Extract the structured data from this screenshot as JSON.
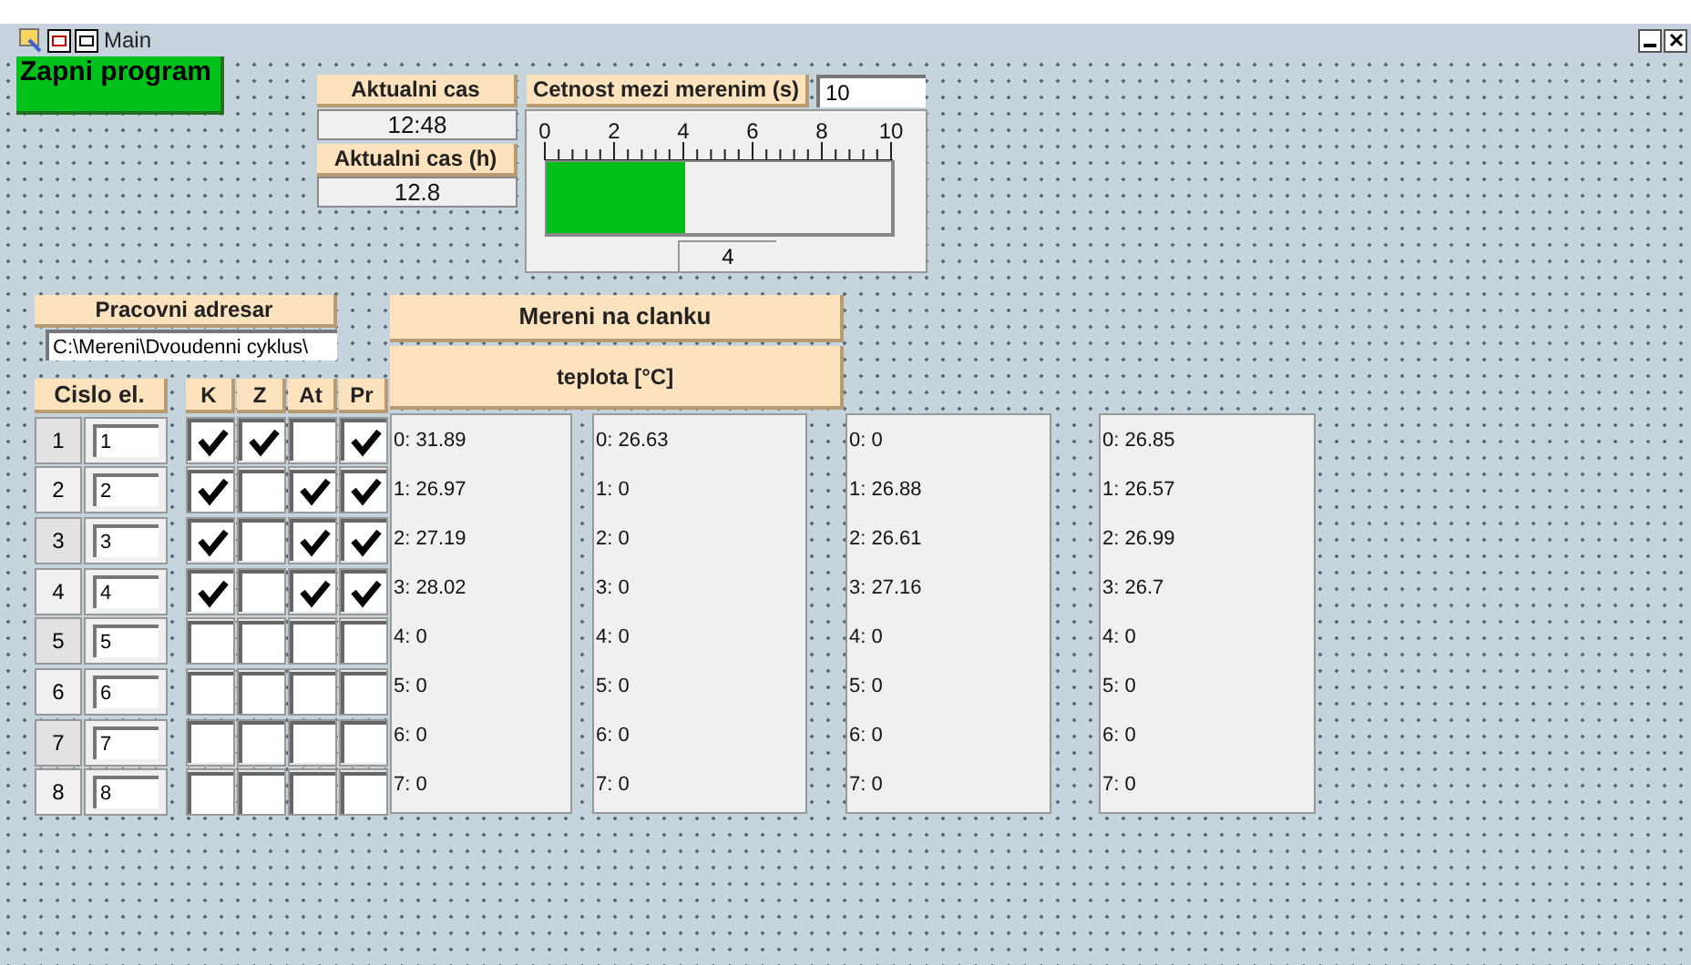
{
  "window": {
    "title": "Main"
  },
  "start_button": {
    "label": "Zapni program",
    "on": true
  },
  "current_time": {
    "label": "Aktualni cas",
    "value": "12:48"
  },
  "current_time_h": {
    "label": "Aktualni cas (h)",
    "value": "12.8"
  },
  "frequency": {
    "label": "Cetnost mezi merenim (s)",
    "value": "10"
  },
  "slider": {
    "ticks": [
      "0",
      "2",
      "4",
      "6",
      "8",
      "10"
    ],
    "level": 0.4,
    "reading": "4"
  },
  "directory": {
    "label": "Pracovni adresar",
    "value": "C:\\Mereni\\Dvoudenni cyklus\\"
  },
  "measurement": {
    "title": "Mereni na clanku",
    "unit": "teplota [°C]"
  },
  "table": {
    "number_header": "Cislo el.",
    "check_headers": [
      "K",
      "Z",
      "At",
      "Pr"
    ],
    "rows": [
      {
        "number": "1",
        "value": "1",
        "checks": [
          true,
          true,
          false,
          true
        ]
      },
      {
        "number": "2",
        "value": "2",
        "checks": [
          true,
          false,
          true,
          true
        ]
      },
      {
        "number": "3",
        "value": "3",
        "checks": [
          true,
          false,
          true,
          true
        ]
      },
      {
        "number": "4",
        "value": "4",
        "checks": [
          true,
          false,
          true,
          true
        ]
      },
      {
        "number": "5",
        "value": "5",
        "checks": [
          false,
          false,
          false,
          false
        ]
      },
      {
        "number": "6",
        "value": "6",
        "checks": [
          false,
          false,
          false,
          false
        ]
      },
      {
        "number": "7",
        "value": "7",
        "checks": [
          false,
          false,
          false,
          false
        ]
      },
      {
        "number": "8",
        "value": "8",
        "checks": [
          false,
          false,
          false,
          false
        ]
      }
    ]
  },
  "readings": [
    [
      "0: 31.89",
      "1: 26.97",
      "2: 27.19",
      "3: 28.02",
      "4: 0",
      "5: 0",
      "6: 0",
      "7: 0"
    ],
    [
      "0: 26.63",
      "1: 0",
      "2: 0",
      "3: 0",
      "4: 0",
      "5: 0",
      "6: 0",
      "7: 0"
    ],
    [
      "0: 0",
      "1: 26.88",
      "2: 26.61",
      "3: 27.16",
      "4: 0",
      "5: 0",
      "6: 0",
      "7: 0"
    ],
    [
      "0: 26.85",
      "1: 26.57",
      "2: 26.99",
      "3: 26.7",
      "4: 0",
      "5: 0",
      "6: 0",
      "7: 0"
    ]
  ]
}
